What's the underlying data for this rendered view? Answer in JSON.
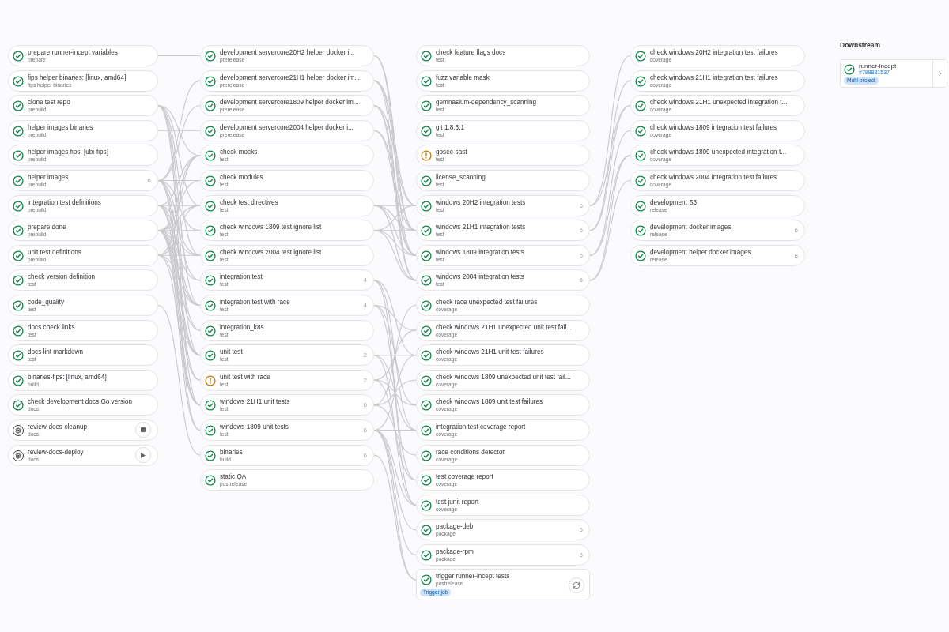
{
  "columns": [
    {
      "jobs": [
        {
          "name": "prepare runner-incept variables",
          "stage": "prepare",
          "kind": "success"
        },
        {
          "name": "fips helper binaries: [linux, amd64]",
          "stage": "fips helper binaries",
          "kind": "success"
        },
        {
          "name": "clone test repo",
          "stage": "prebuild",
          "kind": "success"
        },
        {
          "name": "helper images binaries",
          "stage": "prebuild",
          "kind": "success"
        },
        {
          "name": "helper images fips: [ubi-fips]",
          "stage": "prebuild",
          "kind": "success"
        },
        {
          "name": "helper images",
          "stage": "prebuild",
          "kind": "success",
          "count": "6"
        },
        {
          "name": "integration test definitions",
          "stage": "prebuild",
          "kind": "success"
        },
        {
          "name": "prepare done",
          "stage": "prebuild",
          "kind": "success"
        },
        {
          "name": "unit test definitions",
          "stage": "prebuild",
          "kind": "success"
        },
        {
          "name": "check version definition",
          "stage": "test",
          "kind": "success"
        },
        {
          "name": "code_quality",
          "stage": "test",
          "kind": "success"
        },
        {
          "name": "docs check links",
          "stage": "test",
          "kind": "success"
        },
        {
          "name": "docs lint markdown",
          "stage": "test",
          "kind": "success"
        },
        {
          "name": "binaries-fips: [linux, amd64]",
          "stage": "build",
          "kind": "success"
        },
        {
          "name": "check development docs Go version",
          "stage": "docs",
          "kind": "success"
        },
        {
          "name": "review-docs-cleanup",
          "stage": "docs",
          "kind": "manual",
          "button": {
            "kind": "stop"
          }
        },
        {
          "name": "review-docs-deploy",
          "stage": "docs",
          "kind": "manual",
          "button": {
            "kind": "play"
          }
        }
      ]
    },
    {
      "jobs": [
        {
          "name": "development servercore20H2 helper docker i...",
          "stage": "prerelease",
          "kind": "success"
        },
        {
          "name": "development servercore21H1 helper docker im...",
          "stage": "prerelease",
          "kind": "success"
        },
        {
          "name": "development servercore1809 helper docker im...",
          "stage": "prerelease",
          "kind": "success"
        },
        {
          "name": "development servercore2004 helper docker i...",
          "stage": "prerelease",
          "kind": "success"
        },
        {
          "name": "check mocks",
          "stage": "test",
          "kind": "success"
        },
        {
          "name": "check modules",
          "stage": "test",
          "kind": "success"
        },
        {
          "name": "check test directives",
          "stage": "test",
          "kind": "success"
        },
        {
          "name": "check windows 1809 test ignore list",
          "stage": "test",
          "kind": "success"
        },
        {
          "name": "check windows 2004 test ignore list",
          "stage": "test",
          "kind": "success"
        },
        {
          "name": "integration test",
          "stage": "test",
          "kind": "success",
          "count": "4"
        },
        {
          "name": "integration test with race",
          "stage": "test",
          "kind": "success",
          "count": "4"
        },
        {
          "name": "integration_k8s",
          "stage": "test",
          "kind": "success"
        },
        {
          "name": "unit test",
          "stage": "test",
          "kind": "success",
          "count": "2"
        },
        {
          "name": "unit test with race",
          "stage": "test",
          "kind": "warning",
          "count": "2"
        },
        {
          "name": "windows 21H1 unit tests",
          "stage": "test",
          "kind": "success",
          "count": "6"
        },
        {
          "name": "windows 1809 unit tests",
          "stage": "test",
          "kind": "success",
          "count": "6"
        },
        {
          "name": "binaries",
          "stage": "build",
          "kind": "success",
          "count": "6"
        },
        {
          "name": "static QA",
          "stage": "postrelease",
          "kind": "success"
        }
      ]
    },
    {
      "jobs": [
        {
          "name": "check feature flags docs",
          "stage": "test",
          "kind": "success"
        },
        {
          "name": "fuzz variable mask",
          "stage": "test",
          "kind": "success"
        },
        {
          "name": "gemnasium-dependency_scanning",
          "stage": "test",
          "kind": "success"
        },
        {
          "name": "git 1.8.3.1",
          "stage": "test",
          "kind": "success"
        },
        {
          "name": "gosec-sast",
          "stage": "test",
          "kind": "warning"
        },
        {
          "name": "license_scanning",
          "stage": "test",
          "kind": "success"
        },
        {
          "name": "windows 20H2 integration tests",
          "stage": "test",
          "kind": "success",
          "count": "6"
        },
        {
          "name": "windows 21H1 integration tests",
          "stage": "test",
          "kind": "success",
          "count": "6"
        },
        {
          "name": "windows 1809 integration tests",
          "stage": "test",
          "kind": "success",
          "count": "6"
        },
        {
          "name": "windows 2004 integration tests",
          "stage": "test",
          "kind": "success",
          "count": "6"
        },
        {
          "name": "check race unexpected test failures",
          "stage": "coverage",
          "kind": "success"
        },
        {
          "name": "check windows 21H1 unexpected unit test fail...",
          "stage": "coverage",
          "kind": "success"
        },
        {
          "name": "check windows 21H1 unit test failures",
          "stage": "coverage",
          "kind": "success"
        },
        {
          "name": "check windows 1809 unexpected unit test fail...",
          "stage": "coverage",
          "kind": "success"
        },
        {
          "name": "check windows 1809 unit test failures",
          "stage": "coverage",
          "kind": "success"
        },
        {
          "name": "integration test coverage report",
          "stage": "coverage",
          "kind": "success"
        },
        {
          "name": "race conditions detector",
          "stage": "coverage",
          "kind": "success"
        },
        {
          "name": "test coverage report",
          "stage": "coverage",
          "kind": "success"
        },
        {
          "name": "test junit report",
          "stage": "coverage",
          "kind": "success"
        },
        {
          "name": "package-deb",
          "stage": "package",
          "kind": "success",
          "count": "5"
        },
        {
          "name": "package-rpm",
          "stage": "package",
          "kind": "success",
          "count": "6"
        },
        {
          "name": "trigger runner-incept tests",
          "stage": "postrelease",
          "kind": "success",
          "badge": "Trigger job",
          "button": {
            "kind": "retry"
          }
        }
      ]
    },
    {
      "jobs": [
        {
          "name": "check windows 20H2 integration test failures",
          "stage": "coverage",
          "kind": "success"
        },
        {
          "name": "check windows 21H1 integration test failures",
          "stage": "coverage",
          "kind": "success"
        },
        {
          "name": "check windows 21H1 unexpected integration t...",
          "stage": "coverage",
          "kind": "success"
        },
        {
          "name": "check windows 1809 integration test failures",
          "stage": "coverage",
          "kind": "success"
        },
        {
          "name": "check windows 1809 unexpected integration t...",
          "stage": "coverage",
          "kind": "success"
        },
        {
          "name": "check windows 2004 integration test failures",
          "stage": "coverage",
          "kind": "success"
        },
        {
          "name": "development S3",
          "stage": "release",
          "kind": "success"
        },
        {
          "name": "development docker images",
          "stage": "release",
          "kind": "success",
          "count": "6"
        },
        {
          "name": "development helper docker images",
          "stage": "release",
          "kind": "success",
          "count": "8"
        }
      ]
    }
  ],
  "downstream": {
    "title": "Downstream",
    "pipelines": [
      {
        "name": "runner-incept",
        "id": "#798881537",
        "badge": "Multi-project",
        "kind": "success"
      }
    ]
  }
}
